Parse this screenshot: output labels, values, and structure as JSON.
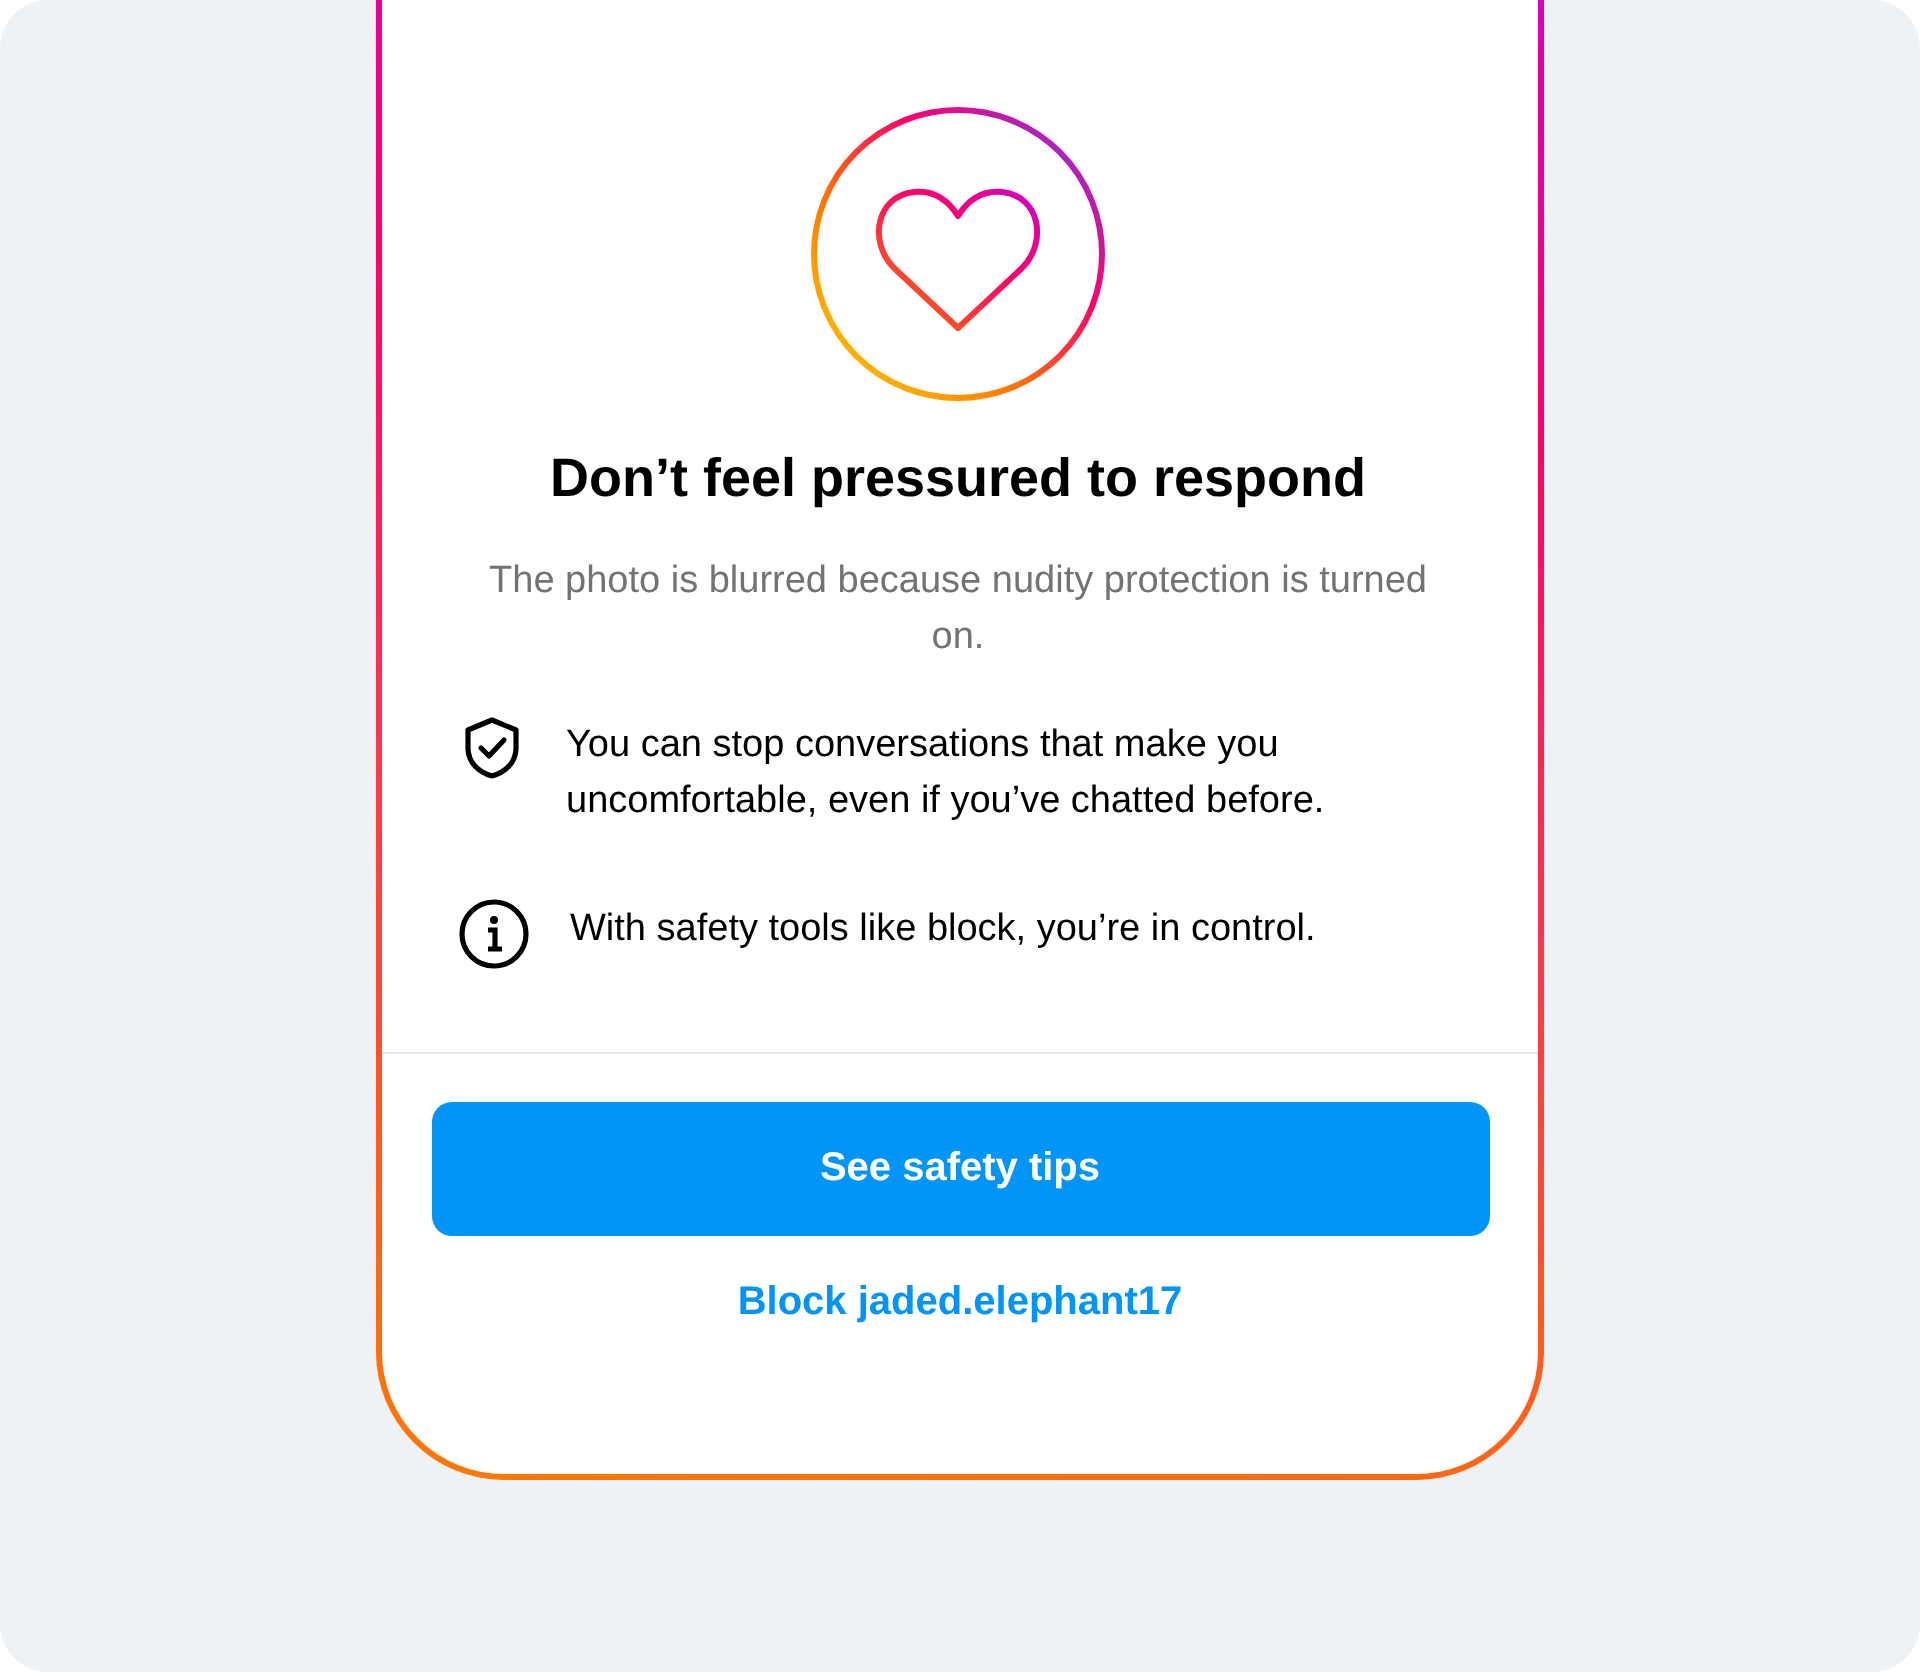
{
  "title": "Don’t feel pressured to respond",
  "subtitle": "The photo is blurred because nudity protection is turned on.",
  "tips": [
    {
      "kind": "shield",
      "text": "You can stop conversations that make you uncomfortable, even if you’ve chatted before."
    },
    {
      "kind": "info",
      "text": "With safety tools like block, you’re in control."
    }
  ],
  "primary_button": "See safety tips",
  "block_link": "Block jaded.elephant17"
}
